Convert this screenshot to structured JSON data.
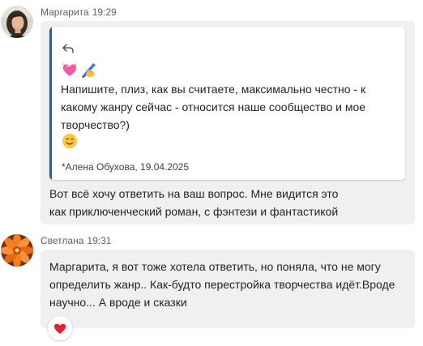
{
  "messages": [
    {
      "author": "Маргарита",
      "time": "19:29",
      "avatar": "woman-portrait-avatar",
      "quote": {
        "icon": "reply-arrow-icon",
        "emojis": [
          "heart-sparkle-emoji",
          "writing-hand-emoji"
        ],
        "text": "Напишите, плиз, как вы считаете, максимально честно - к какому жанру сейчас - относится наше сообщество и мое творчество?)",
        "smile": "smiling-face-emoji",
        "signature": "*Алена Обухова, 19.04.2025"
      },
      "text": "Вот всё хочу ответить на ваш вопрос. Мне видится это как приключенческий роман, с фэнтези и фантастикой"
    },
    {
      "author": "Светлана",
      "time": "19:31",
      "avatar": "orange-flower-avatar",
      "text": "Маргарита, я вот тоже хотела ответить, но поняла, что не могу определить жанр.. Как-будто перестройка творчества идёт.Вроде научно... А вроде и сказки",
      "reaction": "red-heart-icon"
    }
  ],
  "colors": {
    "bubble": "#f0f0f0",
    "quote_accent": "#0f6cbd",
    "heart": "#e0242e",
    "meta_text": "#616161"
  }
}
